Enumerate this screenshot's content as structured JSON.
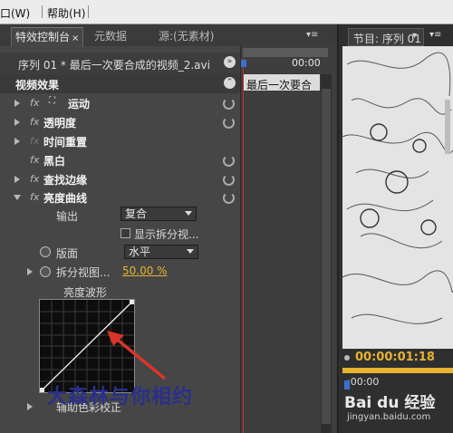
{
  "menubar": {
    "items": [
      "口(W)",
      "帮助(H)"
    ]
  },
  "tabs": {
    "effect_controls": "特效控制台",
    "metadata": "元数据",
    "source": "源:(无素材)"
  },
  "header": {
    "clip_title": "序列 01 * 最后一次要合成的视频_2.avi",
    "timecode": "00:00",
    "clip_label": "最后一次要合"
  },
  "video_effects": {
    "title": "视频效果",
    "items": [
      {
        "label": "运动"
      },
      {
        "label": "透明度"
      },
      {
        "label": "时间重置"
      },
      {
        "label": "黑白"
      },
      {
        "label": "查找边缘"
      },
      {
        "label": "亮度曲线"
      }
    ]
  },
  "luma": {
    "output_label": "输出",
    "output_value": "复合",
    "split_checkbox_label": "显示拆分视...",
    "layout_label": "版面",
    "layout_value": "水平",
    "split_percent_label": "拆分视图...",
    "split_percent_value": "50.00 %",
    "waveform_label": "亮度波形",
    "aux_label": "辅助色彩校正"
  },
  "program": {
    "tab_label": "节目: 序列 01",
    "timecode": "00:00:01:18",
    "ruler_time": ":00:00"
  },
  "watermark": {
    "text": "大森林与你相约",
    "brand": "Bai du 经验",
    "url": "jingyan.baidu.com"
  },
  "colors": {
    "accent_timecode": "#e6b430",
    "playhead": "#cf2a2a",
    "annotation_arrow": "#d9352a"
  }
}
